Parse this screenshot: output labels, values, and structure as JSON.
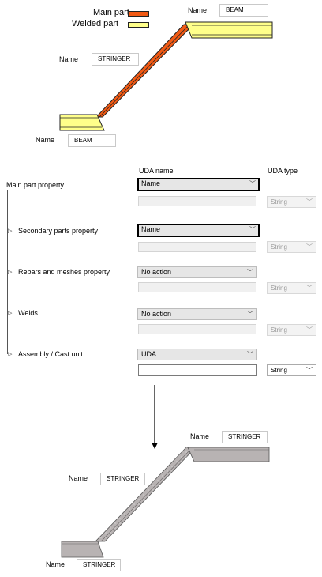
{
  "legend": {
    "main_part_label": "Main part",
    "welded_part_label": "Welded part",
    "main_part_color": "#f25a14",
    "welded_part_color": "#ffff8a"
  },
  "before_labels": {
    "top_name_label": "Name",
    "top_name_value": "BEAM",
    "middle_name_label": "Name",
    "middle_name_value": "STRINGER",
    "bottom_name_label": "Name",
    "bottom_name_value": "BEAM"
  },
  "headers": {
    "uda_name": "UDA name",
    "uda_type": "UDA type"
  },
  "rows": [
    {
      "label": "Main part property",
      "combo": "Name",
      "type": "String"
    },
    {
      "label": "Secondary parts property",
      "combo": "Name",
      "type": "String"
    },
    {
      "label": "Rebars and meshes property",
      "combo": "No action",
      "type": "String"
    },
    {
      "label": "Welds",
      "combo": "No action",
      "type": "String"
    },
    {
      "label": "Assembly / Cast unit",
      "combo": "UDA",
      "type": "String"
    }
  ],
  "after_labels": {
    "top_name_label": "Name",
    "top_name_value": "STRINGER",
    "middle_name_label": "Name",
    "middle_name_value": "STRINGER",
    "bottom_name_label": "Name",
    "bottom_name_value": "STRINGER"
  },
  "after_color": "#b8b3b3"
}
